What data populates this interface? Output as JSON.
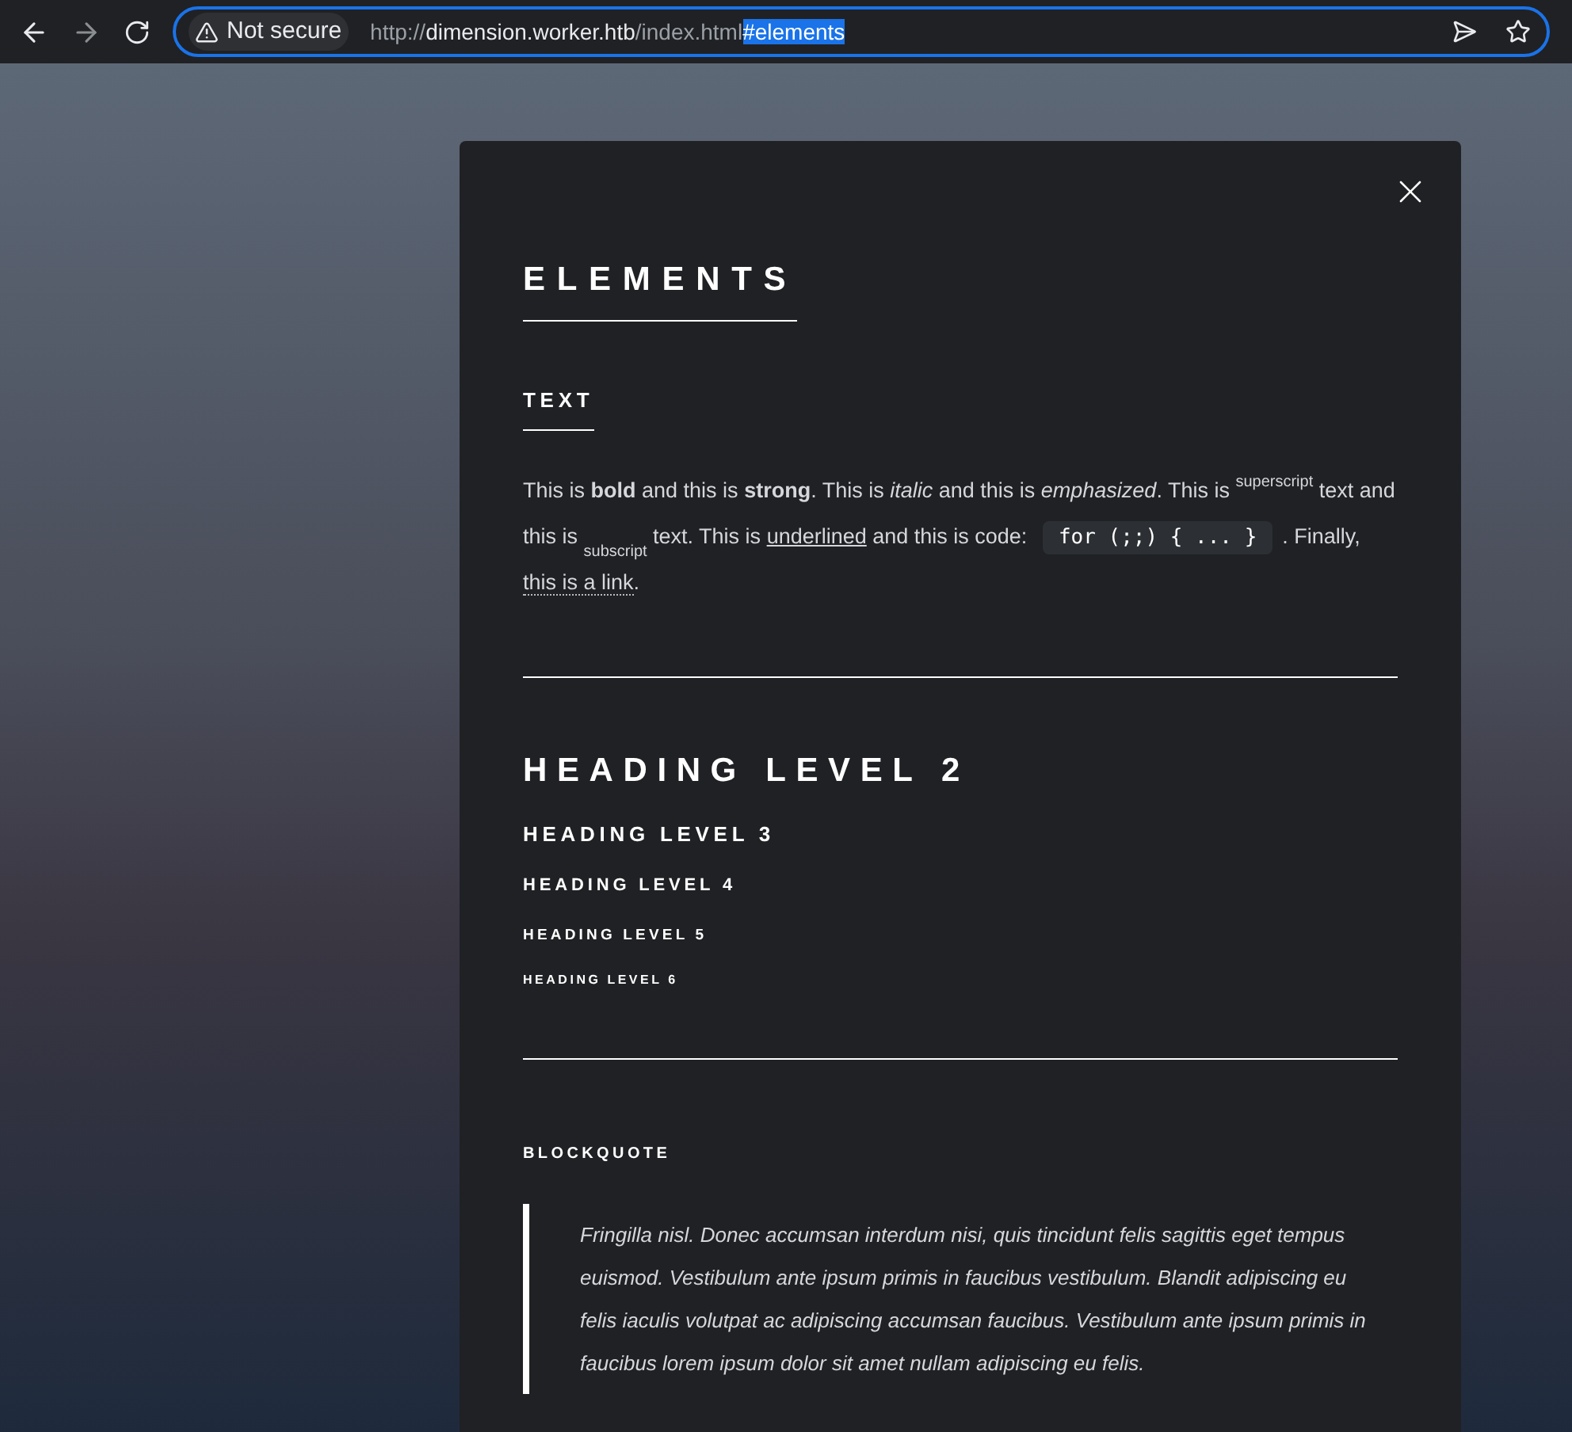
{
  "browser": {
    "security": "Not secure",
    "url_parts": [
      {
        "text": "http://",
        "kind": "dim"
      },
      {
        "text": "dimension.worker.htb",
        "kind": "host"
      },
      {
        "text": "/index.html",
        "kind": "dim"
      },
      {
        "text": "#elements",
        "kind": "selected"
      }
    ]
  },
  "article": {
    "title": "ELEMENTS",
    "text_section": {
      "heading": "TEXT",
      "paragraph": [
        {
          "kind": "text",
          "text": "This is **bold** and this is **strong**. This is *italic* and this is *emphasized*. This is "
        },
        {
          "kind": "sup",
          "text": "superscript"
        },
        {
          "kind": "text",
          "text": " text and this is "
        },
        {
          "kind": "sub",
          "text": "subscript"
        },
        {
          "kind": "text",
          "text": " text. This is "
        },
        {
          "kind": "underline",
          "text": "underlined"
        },
        {
          "kind": "text",
          "text": " and this is code: "
        },
        {
          "kind": "code",
          "text": "for (;;) { ... }"
        },
        {
          "kind": "text",
          "text": ". Finally, "
        },
        {
          "kind": "link",
          "text": "this is a link"
        },
        {
          "kind": "text",
          "text": "."
        }
      ]
    },
    "headings": [
      {
        "kind": "h2",
        "text": "HEADING LEVEL 2"
      },
      {
        "kind": "h3",
        "text": "HEADING LEVEL 3"
      },
      {
        "kind": "h4",
        "text": "HEADING LEVEL 4"
      },
      {
        "kind": "h5",
        "text": "HEADING LEVEL 5"
      },
      {
        "kind": "h6",
        "text": "HEADING LEVEL 6"
      }
    ],
    "blockquote": {
      "heading": "BLOCKQUOTE",
      "text": "Fringilla nisl. Donec accumsan interdum nisi, quis tincidunt felis sagittis eget tempus euismod. Vestibulum ante ipsum primis in faucibus vestibulum. Blandit adipiscing eu felis iaculis volutpat ac adipiscing accumsan faucibus. Vestibulum ante ipsum primis in faucibus lorem ipsum dolor sit amet nullam adipiscing eu felis."
    }
  }
}
